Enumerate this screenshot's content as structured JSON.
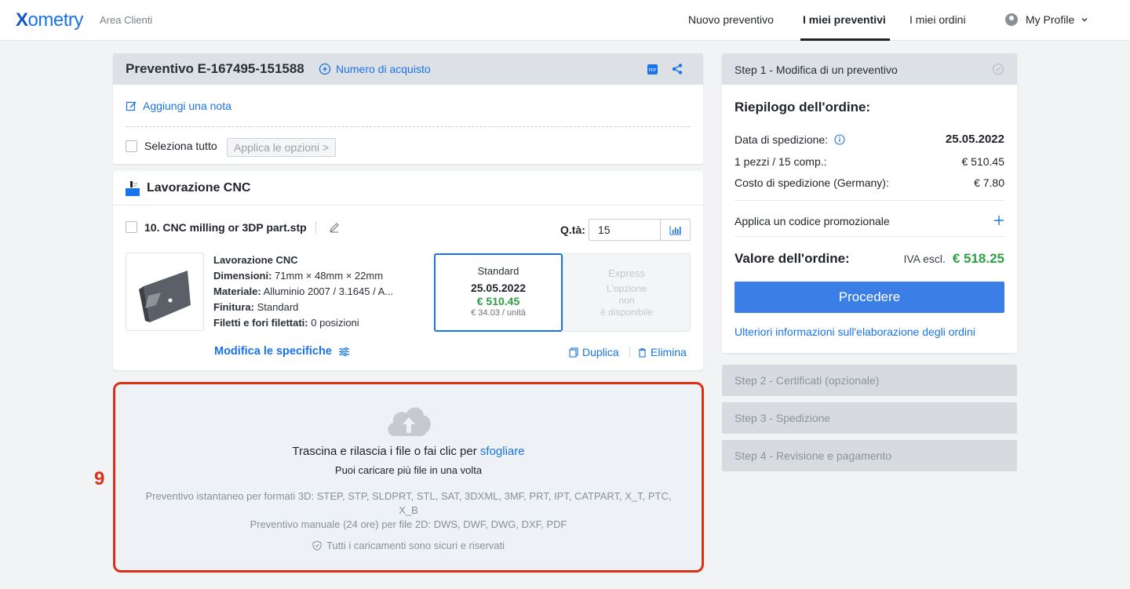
{
  "header": {
    "logo": "Xometry",
    "area_label": "Area Clienti",
    "nav": [
      "Nuovo preventivo",
      "I miei preventivi",
      "I miei ordini"
    ],
    "profile_label": "My Profile"
  },
  "quote": {
    "title": "Preventivo E-167495-151588",
    "purchase_number_link": "Numero di acquisto",
    "add_note": "Aggiungi una nota",
    "select_all": "Seleziona tutto",
    "apply_options": "Applica le opzioni >"
  },
  "section": {
    "title": "Lavorazione CNC"
  },
  "part": {
    "name": "10. CNC milling or 3DP part.stp",
    "qty_label": "Q.tà:",
    "qty_value": "15",
    "process": "Lavorazione CNC",
    "dimensions_label": "Dimensioni:",
    "dimensions_value": "71mm × 48mm × 22mm",
    "material_label": "Materiale:",
    "material_value": "Alluminio 2007 / 3.1645 / A...",
    "finish_label": "Finitura:",
    "finish_value": "Standard",
    "threads_label": "Filetti e fori filettati:",
    "threads_value": "0 posizioni",
    "edit_specs": "Modifica le specifiche",
    "duplicate": "Duplica",
    "delete": "Elimina",
    "standard": {
      "label": "Standard",
      "date": "25.05.2022",
      "price": "€ 510.45",
      "unit_price": "€ 34.03 / unità"
    },
    "express": {
      "label": "Express",
      "line1": "L'opzione",
      "line2": "non",
      "line3": "è disponibile"
    }
  },
  "upload": {
    "annotation_number": "9",
    "main_text": "Trascina e rilascia i file o fai clic per",
    "browse_link": "sfogliare",
    "multi_text": "Puoi caricare più file in una volta",
    "formats_3d": "Preventivo istantaneo per formati 3D: STEP, STP, SLDPRT, STL, SAT, 3DXML, 3MF, PRT, IPT, CATPART, X_T, PTC,",
    "formats_3d_cont": "X_B",
    "formats_2d": "Preventivo manuale (24 ore) per file 2D: DWS, DWF, DWG, DXF, PDF",
    "secure": "Tutti i caricamenti sono sicuri e riservati"
  },
  "summary": {
    "step1_title": "Step 1 - Modifica di un preventivo",
    "heading": "Riepilogo dell'ordine:",
    "ship_date_label": "Data di spedizione:",
    "ship_date_value": "25.05.2022",
    "parts_label": "1 pezzi / 15 comp.:",
    "parts_value": "€ 510.45",
    "ship_cost_label": "Costo di spedizione (Germany):",
    "ship_cost_value": "€ 7.80",
    "promo": "Applica un codice promozionale",
    "total_label": "Valore dell'ordine:",
    "total_tax": "IVA escl.",
    "total_value": "€ 518.25",
    "proceed": "Procedere",
    "more_info": "Ulteriori informazioni sull'elaborazione degli ordini"
  },
  "steps": [
    "Step 2 - Certificati (opzionale)",
    "Step 3 - Spedizione",
    "Step 4 - Revisione e pagamento"
  ],
  "colors": {
    "accent": "#1a73e8",
    "price_green": "#2ea043",
    "annotation_red": "#d93016"
  }
}
